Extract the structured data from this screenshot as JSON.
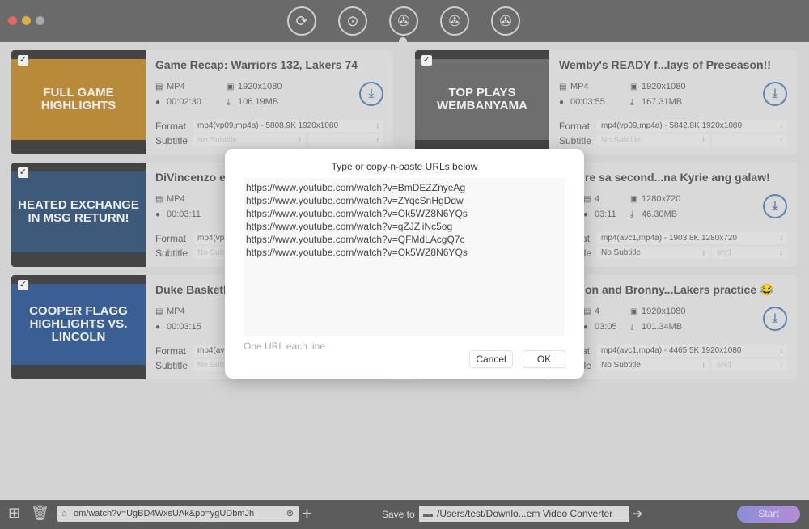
{
  "toolbar": {
    "icons": [
      "convert-icon",
      "record-icon",
      "download-icon",
      "edit-icon",
      "tools-icon"
    ],
    "selected_index": 2
  },
  "cards": [
    {
      "title": "Game Recap: Warriors 132, Lakers 74",
      "container": "MP4",
      "duration": "00:02:30",
      "resolution": "1920x1080",
      "size": "106.19MB",
      "format": "mp4(vp09,mp4a) - 5808.9K 1920x1080",
      "subtitle": "No Subtitle",
      "subtitle2": "",
      "thumb_text": "FULL GAME HIGHLIGHTS",
      "thumb_color": "#b88a3a",
      "checked": true
    },
    {
      "title": "Wemby's READY f...lays of Preseason!!",
      "container": "MP4",
      "duration": "00:03:55",
      "resolution": "1920x1080",
      "size": "167.31MB",
      "format": "mp4(vp09,mp4a) - 5842.8K 1920x1080",
      "subtitle": "No Subtitle",
      "subtitle2": "",
      "thumb_text": "TOP PLAYS WEMBANYAMA",
      "thumb_color": "#6e6e6e",
      "checked": true
    },
    {
      "title": "DiVincenzo ex",
      "container": "MP4",
      "duration": "00:03:11",
      "resolution": "",
      "size": "",
      "format": "mp4(vp",
      "subtitle": "No Sub",
      "subtitle2": "",
      "thumb_text": "HEATED EXCHANGE IN MSG RETURN!",
      "thumb_color": "#3d5a7a",
      "checked": true
    },
    {
      "title": "re sa second...na Kyrie ang galaw!",
      "container": "4",
      "duration": "03:11",
      "resolution": "1280x720",
      "size": "46.30MB",
      "format": "mp4(avc1,mp4a) - 1903.8K 1280x720",
      "subtitle": "No Subtitle",
      "subtitle2": "srv1",
      "thumb_text": "",
      "thumb_color": "#555",
      "checked": true
    },
    {
      "title": "Duke Basketb",
      "container": "MP4",
      "duration": "00:03:15",
      "resolution": "",
      "size": "",
      "format": "mp4(av",
      "subtitle": "No Sub",
      "subtitle2": "",
      "thumb_text": "COOPER FLAGG HIGHLIGHTS VS. LINCOLN",
      "thumb_color": "#3a5f95",
      "checked": true
    },
    {
      "title": "on and Bronny...Lakers practice 😂",
      "container": "4",
      "duration": "03:05",
      "resolution": "1920x1080",
      "size": "101.34MB",
      "format": "mp4(avc1,mp4a) - 4465.5K 1920x1080",
      "subtitle": "No Subtitle",
      "subtitle2": "srv1",
      "thumb_text": "",
      "thumb_color": "#555",
      "checked": true
    }
  ],
  "labels": {
    "format": "Format",
    "subtitle": "Subtitle"
  },
  "bottom": {
    "url_value": "om/watch?v=UgBD4WxsUAk&pp=ygUDbmJh",
    "save_to_label": "Save to",
    "save_path": "/Users/test/Downlo...em Video Converter",
    "start_label": "Start"
  },
  "dialog": {
    "title": "Type or copy-n-paste URLs below",
    "urls": "https://www.youtube.com/watch?v=BmDEZZnyeAg\nhttps://www.youtube.com/watch?v=ZYqcSnHgDdw\nhttps://www.youtube.com/watch?v=Ok5WZ8N6YQs\nhttps://www.youtube.com/watch?v=qZJZiiNc5og\nhttps://www.youtube.com/watch?v=QFMdLAcgQ7c\nhttps://www.youtube.com/watch?v=Ok5WZ8N6YQs",
    "hint": "One URL each line",
    "cancel_label": "Cancel",
    "ok_label": "OK"
  }
}
